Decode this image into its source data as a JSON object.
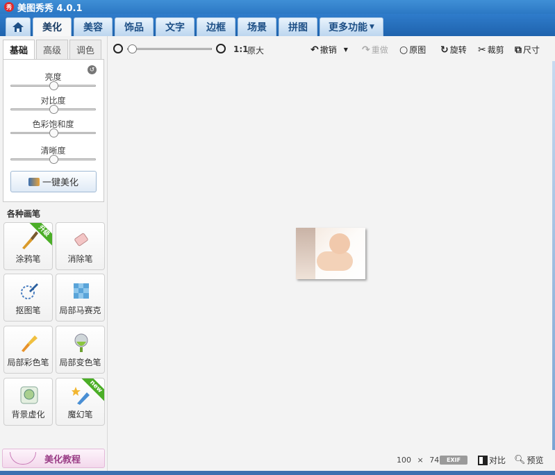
{
  "app": {
    "title": "美图秀秀 4.0.1",
    "logo_text": "秀"
  },
  "nav": {
    "home_icon": "home-icon",
    "tabs": [
      "美化",
      "美容",
      "饰品",
      "文字",
      "边框",
      "场景",
      "拼图"
    ],
    "active": "美化",
    "more_label": "更多功能"
  },
  "left": {
    "subtabs": [
      "基础",
      "高级",
      "调色"
    ],
    "active_subtab": "基础",
    "sliders": [
      {
        "label": "亮度",
        "value": 0.5
      },
      {
        "label": "对比度",
        "value": 0.5
      },
      {
        "label": "色彩饱和度",
        "value": 0.5
      },
      {
        "label": "清晰度",
        "value": 0.5
      }
    ],
    "onekey_label": "一键美化",
    "brushes_title": "各种画笔",
    "brushes": [
      {
        "label": "涂鸦笔",
        "icon": "paintbrush-icon",
        "badge": "升级"
      },
      {
        "label": "消除笔",
        "icon": "eraser-icon",
        "badge": ""
      },
      {
        "label": "抠图笔",
        "icon": "cutout-pen-icon",
        "badge": ""
      },
      {
        "label": "局部马赛克",
        "icon": "mosaic-icon",
        "badge": ""
      },
      {
        "label": "局部彩色笔",
        "icon": "color-brush-icon",
        "badge": ""
      },
      {
        "label": "局部变色笔",
        "icon": "color-change-icon",
        "badge": ""
      },
      {
        "label": "背景虚化",
        "icon": "blur-icon",
        "badge": ""
      },
      {
        "label": "魔幻笔",
        "icon": "magic-pen-icon",
        "badge": "new"
      }
    ],
    "tutorial_label": "美化教程"
  },
  "toolbar": {
    "zoom_ratio": "1:1",
    "zoom_actual": "原大",
    "undo": "撤销",
    "redo": "重做",
    "original": "原图",
    "rotate": "旋转",
    "crop": "裁剪",
    "size": "尺寸"
  },
  "status": {
    "width": "100",
    "times": "×",
    "height": "74",
    "exif": "EXIF",
    "compare": "对比",
    "preview": "预览"
  }
}
